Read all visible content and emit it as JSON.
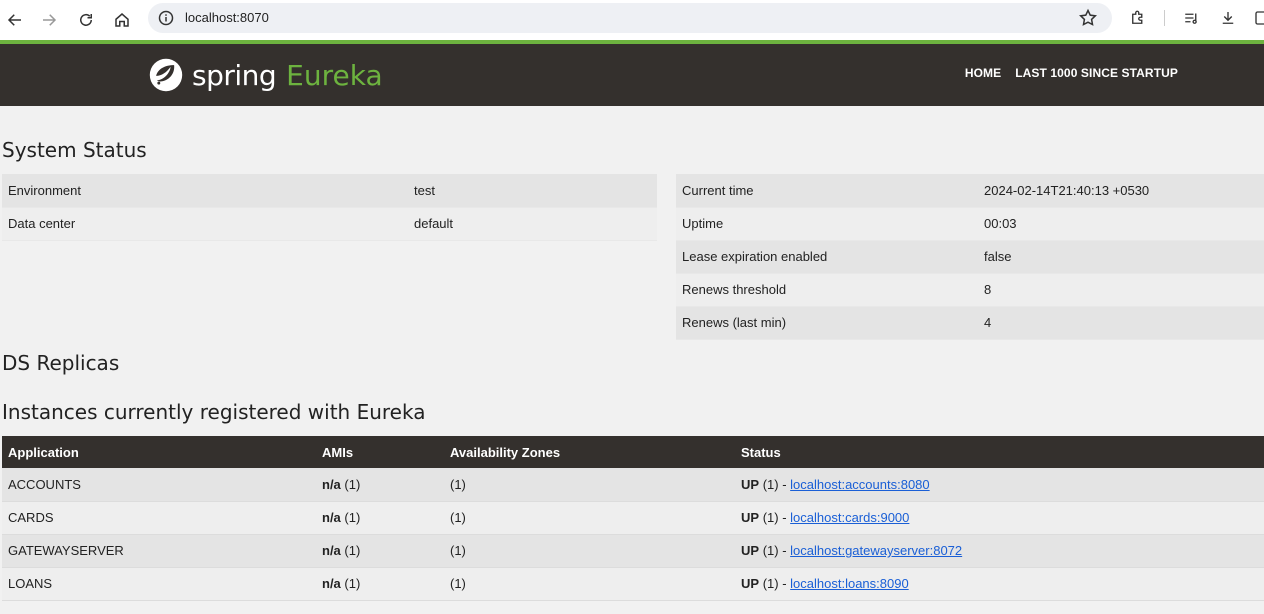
{
  "browser": {
    "url": "localhost:8070"
  },
  "header": {
    "logo_spring": "spring",
    "logo_eureka": "Eureka",
    "nav": [
      "HOME",
      "LAST 1000 SINCE STARTUP"
    ]
  },
  "system_status": {
    "title": "System Status",
    "left": [
      {
        "label": "Environment",
        "value": "test"
      },
      {
        "label": "Data center",
        "value": "default"
      }
    ],
    "right": [
      {
        "label": "Current time",
        "value": "2024-02-14T21:40:13 +0530"
      },
      {
        "label": "Uptime",
        "value": "00:03"
      },
      {
        "label": "Lease expiration enabled",
        "value": "false"
      },
      {
        "label": "Renews threshold",
        "value": "8"
      },
      {
        "label": "Renews (last min)",
        "value": "4"
      }
    ]
  },
  "ds_replicas": {
    "title": "DS Replicas"
  },
  "instances": {
    "title": "Instances currently registered with Eureka",
    "columns": [
      "Application",
      "AMIs",
      "Availability Zones",
      "Status"
    ],
    "rows": [
      {
        "app": "ACCOUNTS",
        "ami_bold": "n/a",
        "ami_count": "(1)",
        "zones": "(1)",
        "status_bold": "UP",
        "status_count": "(1) -",
        "link": "localhost:accounts:8080"
      },
      {
        "app": "CARDS",
        "ami_bold": "n/a",
        "ami_count": "(1)",
        "zones": "(1)",
        "status_bold": "UP",
        "status_count": "(1) -",
        "link": "localhost:cards:9000"
      },
      {
        "app": "GATEWAYSERVER",
        "ami_bold": "n/a",
        "ami_count": "(1)",
        "zones": "(1)",
        "status_bold": "UP",
        "status_count": "(1) -",
        "link": "localhost:gatewayserver:8072"
      },
      {
        "app": "LOANS",
        "ami_bold": "n/a",
        "ami_count": "(1)",
        "zones": "(1)",
        "status_bold": "UP",
        "status_count": "(1) -",
        "link": "localhost:loans:8090"
      }
    ]
  },
  "colors": {
    "brand_green": "#6db33f",
    "header_dark": "#34302d",
    "link_blue": "#1a5fd6"
  },
  "icons": [
    "back-icon",
    "forward-icon",
    "reload-icon",
    "home-icon",
    "info-icon",
    "star-icon",
    "extensions-icon",
    "media-icon",
    "download-icon",
    "sidepanel-icon",
    "spring-leaf-icon"
  ]
}
